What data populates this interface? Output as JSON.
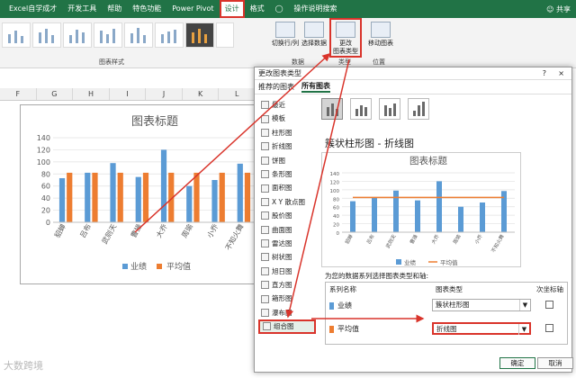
{
  "ribbon_tabs": [
    "Excel自学成才",
    "开发工具",
    "帮助",
    "特色功能",
    "Power Pivot",
    "设计",
    "格式"
  ],
  "active_tab_index": 5,
  "search": "操作说明搜索",
  "share": "共享",
  "ribbon": {
    "styles_group": "图表样式",
    "data_group": "数据",
    "type_group": "类型",
    "location_group": "位置",
    "switch_row_col": "切换行/列",
    "select_data": "选择数据",
    "change_chart_type": "更改\n图表类型",
    "move_chart": "移动图表"
  },
  "columns": [
    "F",
    "G",
    "H",
    "I",
    "J",
    "K",
    "L"
  ],
  "chart": {
    "title": "图表标题",
    "categories": [
      "貂蝉",
      "吕布",
      "武则天",
      "曹操",
      "大乔",
      "周瑜",
      "小乔",
      "不知火舞"
    ],
    "yticks": [
      0,
      20,
      40,
      60,
      80,
      100,
      120,
      140
    ],
    "legend": [
      "业绩",
      "平均值"
    ],
    "colors": {
      "bar": "#5b9bd5",
      "avg": "#ed7d31"
    }
  },
  "chart_data": {
    "type": "bar",
    "title": "图表标题",
    "categories": [
      "貂蝉",
      "吕布",
      "武则天",
      "曹操",
      "大乔",
      "周瑜",
      "小乔",
      "不知火舞"
    ],
    "series": [
      {
        "name": "业绩",
        "values": [
          73,
          82,
          98,
          75,
          120,
          60,
          70,
          97
        ]
      },
      {
        "name": "平均值",
        "values": [
          82,
          82,
          82,
          82,
          82,
          82,
          82,
          82
        ]
      }
    ],
    "ylim": [
      0,
      140
    ]
  },
  "dialog": {
    "title": "更改图表类型",
    "help": "?",
    "close": "×",
    "tabs": [
      "推荐的图表",
      "所有图表"
    ],
    "types": [
      "最近",
      "模板",
      "柱形图",
      "折线图",
      "饼图",
      "条形图",
      "面积图",
      "X Y 散点图",
      "股价图",
      "曲面图",
      "雷达图",
      "树状图",
      "旭日图",
      "直方图",
      "箱形图",
      "瀑布图",
      "组合图"
    ],
    "selected_type_index": 16,
    "preview_heading": "簇状柱形图 - 折线图",
    "preview_chart_title": "图表标题",
    "series_question": "为您的数据系列选择图表类型和轴:",
    "col_series": "系列名称",
    "col_type": "图表类型",
    "col_secondary": "次坐标轴",
    "series": [
      {
        "name": "业绩",
        "chart_type": "簇状柱形图"
      },
      {
        "name": "平均值",
        "chart_type": "折线图"
      }
    ],
    "ok": "确定",
    "cancel": "取消"
  },
  "watermark": "大数跨境"
}
